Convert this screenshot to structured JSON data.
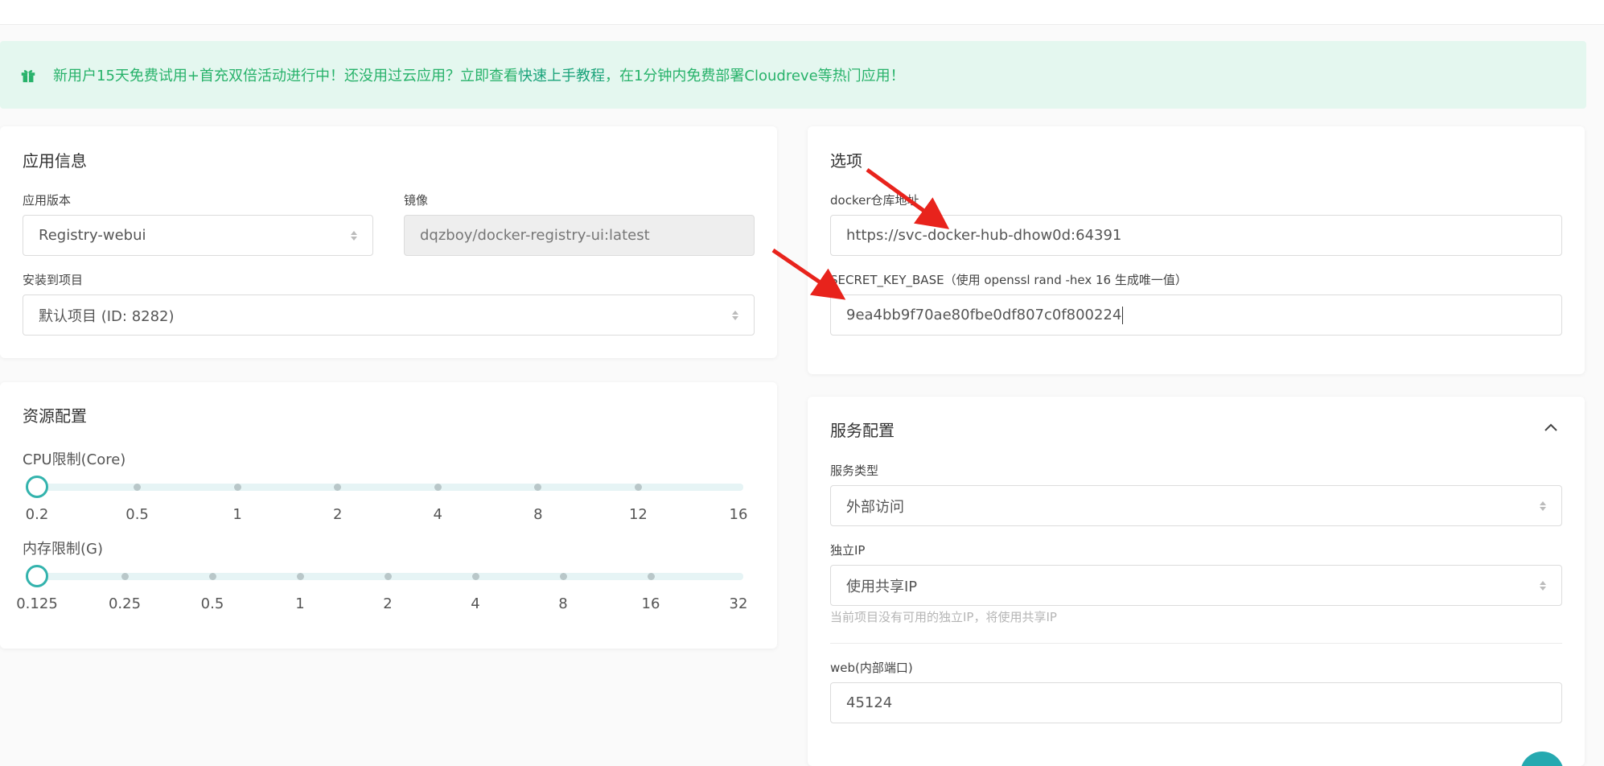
{
  "notice": {
    "text_before": "新用户15天免费试用+首充双倍活动进行中！还没用过云应用？立即查看",
    "link": "快速上手教程",
    "text_after": "，在1分钟内免费部署Cloudreve等热门应用！"
  },
  "app_info": {
    "title": "应用信息",
    "version_label": "应用版本",
    "version_value": "Registry-webui",
    "image_label": "镜像",
    "image_value": "dqzboy/docker-registry-ui:latest",
    "project_label": "安装到项目",
    "project_value": "默认项目 (ID: 8282)"
  },
  "resources": {
    "title": "资源配置",
    "cpu_label": "CPU限制(Core)",
    "cpu_ticks": [
      "0.2",
      "0.5",
      "1",
      "2",
      "4",
      "8",
      "12",
      "16"
    ],
    "cpu_value": "0.2",
    "mem_label": "内存限制(G)",
    "mem_ticks": [
      "0.125",
      "0.25",
      "0.5",
      "1",
      "2",
      "4",
      "8",
      "16",
      "32"
    ],
    "mem_value": "0.125"
  },
  "options": {
    "title": "选项",
    "docker_label": "docker仓库地址",
    "docker_value": "https://svc-docker-hub-dhow0d:64391",
    "secret_label": "SECRET_KEY_BASE（使用 openssl rand -hex 16 生成唯一值）",
    "secret_value": "9ea4bb9f70ae80fbe0df807c0f800224"
  },
  "service": {
    "title": "服务配置",
    "type_label": "服务类型",
    "type_value": "外部访问",
    "ip_label": "独立IP",
    "ip_value": "使用共享IP",
    "ip_hint": "当前项目没有可用的独立IP，将使用共享IP",
    "port_label": "web(内部端口)",
    "port_value": "45124"
  },
  "colors": {
    "accent": "#33b3ad",
    "notice_text": "#27b26a",
    "notice_bg": "#e4f7ef",
    "arrow": "#e8231c"
  }
}
